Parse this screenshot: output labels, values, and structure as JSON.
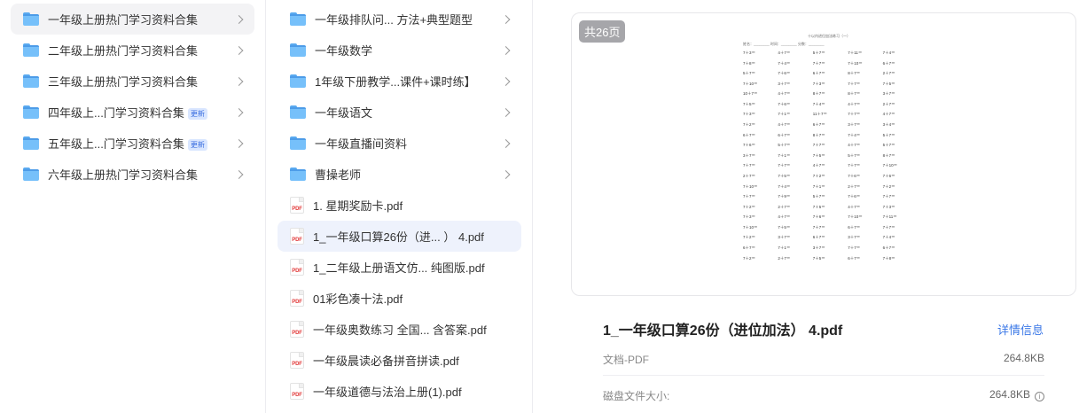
{
  "left_panel": {
    "items": [
      {
        "label": "一年级上册热门学习资料合集",
        "badge": ""
      },
      {
        "label": "二年级上册热门学习资料合集",
        "badge": ""
      },
      {
        "label": "三年级上册热门学习资料合集",
        "badge": ""
      },
      {
        "label": "四年级上...门学习资料合集",
        "badge": "更新"
      },
      {
        "label": "五年级上...门学习资料合集",
        "badge": "更新"
      },
      {
        "label": "六年级上册热门学习资料合集",
        "badge": ""
      }
    ]
  },
  "middle_panel": {
    "folders": [
      "一年级排队问... 方法+典型题型",
      "一年级数学",
      "1年级下册教学...课件+课时练】",
      "一年级语文",
      "一年级直播间资料",
      "曹操老师"
    ],
    "files": [
      "1. 星期奖励卡.pdf",
      "1_一年级口算26份（进... ） 4.pdf",
      "1_二年级上册语文仿... 纯图版.pdf",
      "01彩色凑十法.pdf",
      "一年级奥数练习 全国... 含答案.pdf",
      "一年级晨读必备拼音拼读.pdf",
      "一年级道德与法治上册(1).pdf"
    ],
    "file_icon_label": "PDF"
  },
  "preview": {
    "pages_badge": "共26页",
    "sheet_title": "十以内进位加法练习（一）",
    "sheet_meta": "姓名：________  时间：________  分数：________",
    "sheet_rows": [
      [
        "7＋3＝",
        "4＋7＝",
        "5＋7＝",
        "7＋11＝",
        "7＋4＝"
      ],
      [
        "7＋8＝",
        "7＋4＝",
        "7＋7＝",
        "7＋10＝",
        "6＋7＝"
      ],
      [
        "5＋7＝",
        "7＋6＝",
        "6＋7＝",
        "8＋7＝",
        "2＋7＝"
      ],
      [
        "7＋10＝",
        "3＋7＝",
        "7＋3＝",
        "7＋7＝",
        "7＋5＝"
      ],
      [
        "10＋7＝",
        "4＋7＝",
        "8＋7＝",
        "8＋7＝",
        "3＋7＝"
      ],
      [
        "7＋5＝",
        "7＋6＝",
        "7＋4＝",
        "4＋7＝",
        "2＋7＝"
      ],
      [
        "7＋3＝",
        "7＋1＝",
        "11＋7＝",
        "7＋7＝",
        "4＋7＝"
      ],
      [
        "7＋2＝",
        "4＋7＝",
        "6＋7＝",
        "3＋7＝",
        "3＋4＝"
      ],
      [
        "6＋7＝",
        "6＋7＝",
        "8＋7＝",
        "7＋4＝",
        "5＋7＝"
      ],
      [
        "7＋6＝",
        "5＋7＝",
        "7＋7＝",
        "4＋7＝",
        "5＋7＝"
      ],
      [
        "3＋7＝",
        "7＋1＝",
        "7＋5＝",
        "5＋7＝",
        "8＋7＝"
      ],
      [
        "7＋7＝",
        "7＋7＝",
        "4＋7＝",
        "7＋7＝",
        "7＋10＝"
      ],
      [
        "2＋7＝",
        "7＋5＝",
        "7＋2＝",
        "7＋6＝",
        "7＋6＝"
      ],
      [
        "7＋10＝",
        "7＋4＝",
        "7＋1＝",
        "2＋7＝",
        "7＋2＝"
      ],
      [
        "7＋7＝",
        "7＋9＝",
        "5＋7＝",
        "7＋6＝",
        "7＋7＝"
      ],
      [
        "7＋2＝",
        "2＋7＝",
        "7＋5＝",
        "4＋7＝",
        "7＋3＝"
      ],
      [
        "7＋3＝",
        "4＋7＝",
        "7＋6＝",
        "7＋10＝",
        "7＋11＝"
      ],
      [
        "7＋10＝",
        "7＋5＝",
        "7＋7＝",
        "6＋7＝",
        "7＋7＝"
      ],
      [
        "7＋2＝",
        "3＋7＝",
        "6＋7＝",
        "3＋7＝",
        "7＋4＝"
      ],
      [
        "6＋7＝",
        "7＋1＝",
        "3＋7＝",
        "7＋7＝",
        "6＋7＝"
      ],
      [
        "7＋2＝",
        "2＋7＝",
        "7＋5＝",
        "6＋7＝",
        "7＋8＝"
      ]
    ],
    "sheet_col5": [
      "7＋9＝",
      "3＋7＝",
      "7＋5＝",
      "8＋7＝",
      "7＋4＝",
      "7＋6＝",
      "4＋7＝",
      "7＋7＝",
      "7＋8＝",
      "7＋7＝",
      "7＋2＝",
      "3＋7＝",
      "6＋7＝",
      "4＋7＝",
      "7＋7＝",
      "4＋7＝",
      "4＋7＝",
      "7＋8＝",
      "4＋7＝",
      "3＋7＝",
      "5＋7＝"
    ]
  },
  "details": {
    "file_name": "1_一年级口算26份（进位加法） 4.pdf",
    "detail_link": "详情信息",
    "type_label": "文档-PDF",
    "type_size": "264.8KB",
    "disk_label": "磁盘文件大小:",
    "disk_size": "264.8KB",
    "info_glyph": "i"
  }
}
